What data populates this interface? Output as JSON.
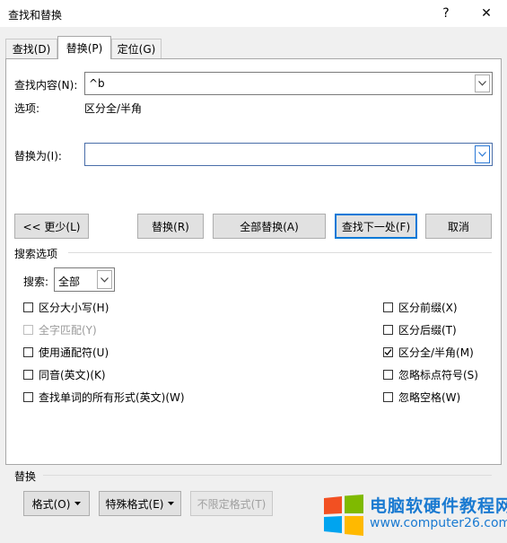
{
  "window": {
    "title": "查找和替换",
    "help": "?",
    "close": "✕"
  },
  "tabs": [
    {
      "label": "查找(D)"
    },
    {
      "label": "替换(P)"
    },
    {
      "label": "定位(G)"
    }
  ],
  "find": {
    "label": "查找内容(N):",
    "value": "^b",
    "options_label": "选项:",
    "options_value": "区分全/半角"
  },
  "replace": {
    "label": "替换为(I):",
    "value": ""
  },
  "buttons": {
    "less": "<< 更少(L)",
    "replace": "替换(R)",
    "replace_all": "全部替换(A)",
    "find_next": "查找下一处(F)",
    "cancel": "取消"
  },
  "search_options": {
    "section_title": "搜索选项",
    "search_label": "搜索:",
    "search_value": "全部",
    "left": [
      {
        "label": "区分大小写(H)",
        "checked": false,
        "disabled": false
      },
      {
        "label": "全字匹配(Y)",
        "checked": false,
        "disabled": true
      },
      {
        "label": "使用通配符(U)",
        "checked": false,
        "disabled": false
      },
      {
        "label": "同音(英文)(K)",
        "checked": false,
        "disabled": false
      },
      {
        "label": "查找单词的所有形式(英文)(W)",
        "checked": false,
        "disabled": false
      }
    ],
    "right": [
      {
        "label": "区分前缀(X)",
        "checked": false,
        "disabled": false
      },
      {
        "label": "区分后缀(T)",
        "checked": false,
        "disabled": false
      },
      {
        "label": "区分全/半角(M)",
        "checked": true,
        "disabled": false
      },
      {
        "label": "忽略标点符号(S)",
        "checked": false,
        "disabled": false
      },
      {
        "label": "忽略空格(W)",
        "checked": false,
        "disabled": false
      }
    ]
  },
  "replace_section": {
    "title": "替换",
    "format": "格式(O)",
    "special": "特殊格式(E)",
    "no_format": "不限定格式(T)"
  },
  "watermark": {
    "text": "电脑软硬件教程网",
    "url": "www.computer26.com"
  },
  "colors": {
    "accent": "#0078d7",
    "watermark": "#1a7ad1"
  }
}
